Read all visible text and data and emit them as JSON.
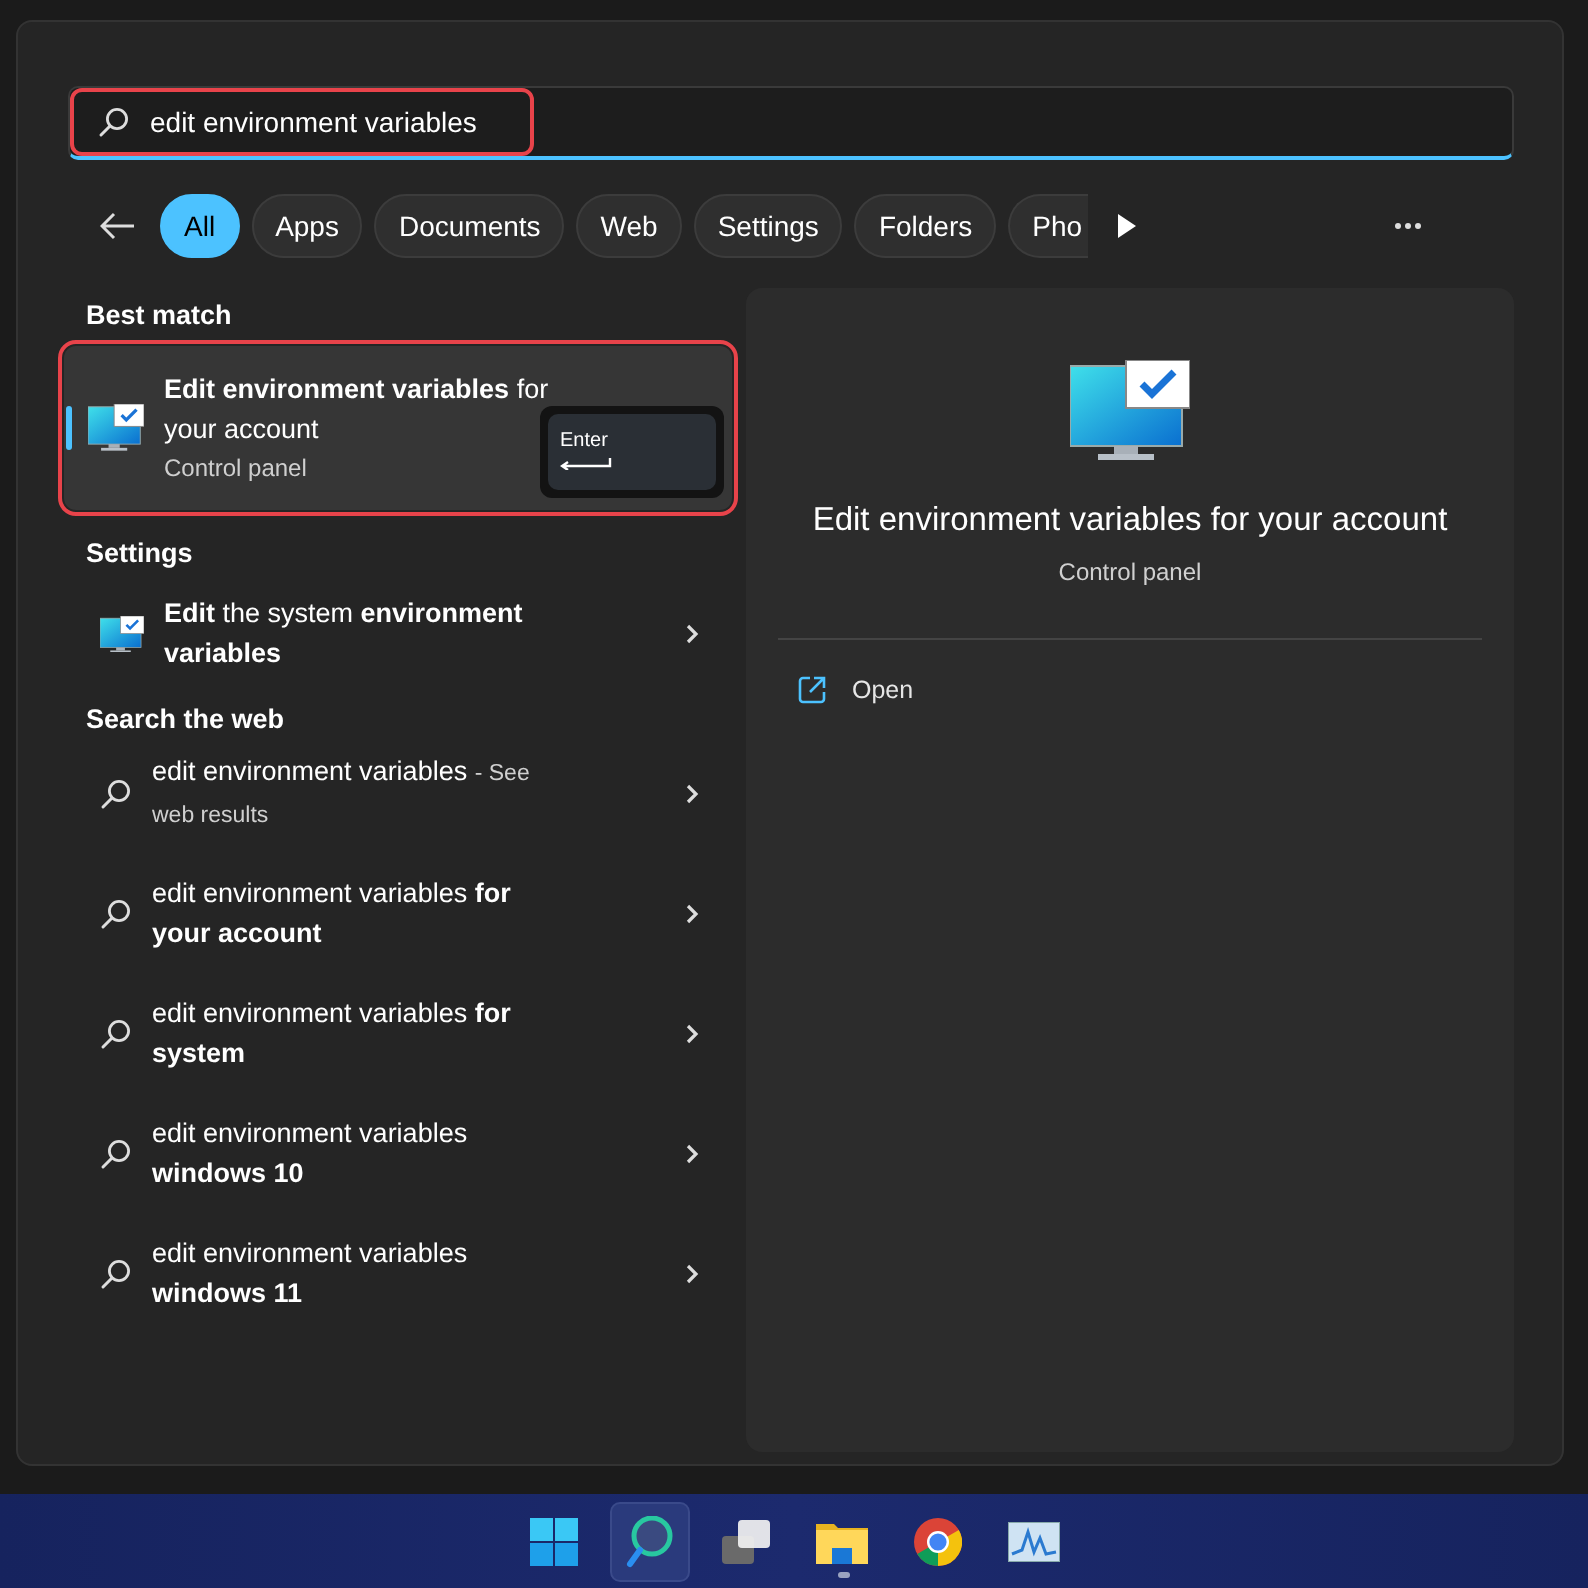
{
  "search": {
    "value": "edit environment variables",
    "highlighted": true
  },
  "filters": [
    {
      "label": "All",
      "selected": true
    },
    {
      "label": "Apps",
      "selected": false
    },
    {
      "label": "Documents",
      "selected": false
    },
    {
      "label": "Web",
      "selected": false
    },
    {
      "label": "Settings",
      "selected": false
    },
    {
      "label": "Folders",
      "selected": false
    },
    {
      "label": "Pho",
      "selected": false
    }
  ],
  "best_match": {
    "heading": "Best match",
    "title": "**Edit environment variables** for your account",
    "subtitle": "Control panel",
    "selected": true,
    "highlighted": true,
    "key_hint": "Enter"
  },
  "settings": {
    "heading": "Settings",
    "items": [
      {
        "title": "**Edit** the system **environment variables**"
      }
    ]
  },
  "web": {
    "heading": "Search the web",
    "items": [
      {
        "title": "edit environment variables",
        "suffix": "- See web results"
      },
      {
        "title": "edit environment variables **for your account**"
      },
      {
        "title": "edit environment variables **for system**"
      },
      {
        "title": "edit environment variables **windows 10**"
      },
      {
        "title": "edit environment variables **windows 11**"
      }
    ]
  },
  "preview": {
    "title": "Edit environment variables for your account",
    "subtitle": "Control panel",
    "actions": [
      {
        "label": "Open"
      }
    ]
  },
  "taskbar": [
    {
      "kind": "start",
      "selected": false,
      "running": false
    },
    {
      "kind": "search",
      "selected": true,
      "running": false
    },
    {
      "kind": "taskview",
      "selected": false,
      "running": false
    },
    {
      "kind": "explorer",
      "selected": false,
      "running": true
    },
    {
      "kind": "browser",
      "selected": false,
      "running": false
    },
    {
      "kind": "monitor",
      "selected": false,
      "running": false
    }
  ]
}
